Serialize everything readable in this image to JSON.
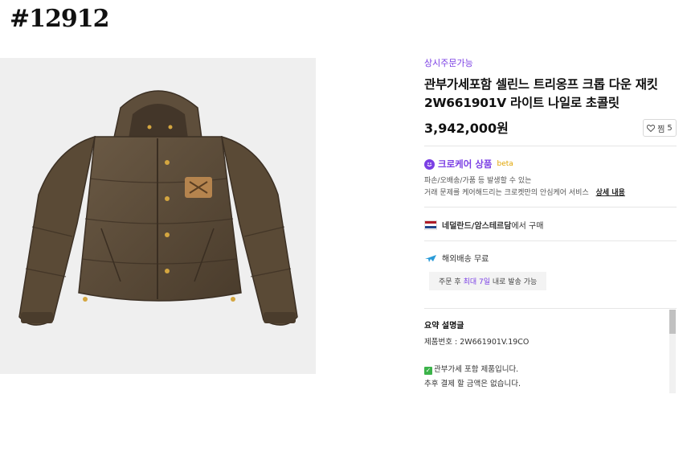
{
  "tag": "#12912",
  "product": {
    "status": "상시주문가능",
    "title": "관부가세포함 셀린느 트리옹프 크롭 다운 재킷 2W661901V 라이트 나일로 초콜릿",
    "price": "3,942,000원",
    "wish_label": "찜",
    "wish_count": "5"
  },
  "crocare": {
    "title": "크로케어 상품",
    "badge": "beta",
    "desc1": "파손/오배송/가품 등 발생할 수 있는",
    "desc2": "거래 문제를 케어해드리는 크로켓만의 안심케어 서비스",
    "link": "상세 내용"
  },
  "origin": {
    "place": "네덜란드/암스테르담",
    "suffix": "에서 구매",
    "flag_colors": [
      "#ae1c28",
      "#ffffff",
      "#21468b"
    ]
  },
  "shipping": {
    "label": "해외배송 무료",
    "note_pre": "주문 후 ",
    "note_highlight": "최대 7일",
    "note_post": " 내로 발송 가능"
  },
  "summary": {
    "title": "요약 설명글",
    "product_number": "제품번호 : 2W661901V.19CO",
    "line1": "관부가세 포함 제품입니다.",
    "line2": "추후 결제 할 금액은 없습니다."
  },
  "colors": {
    "accent": "#7b3fe4",
    "jacket": "#5a4a36"
  }
}
